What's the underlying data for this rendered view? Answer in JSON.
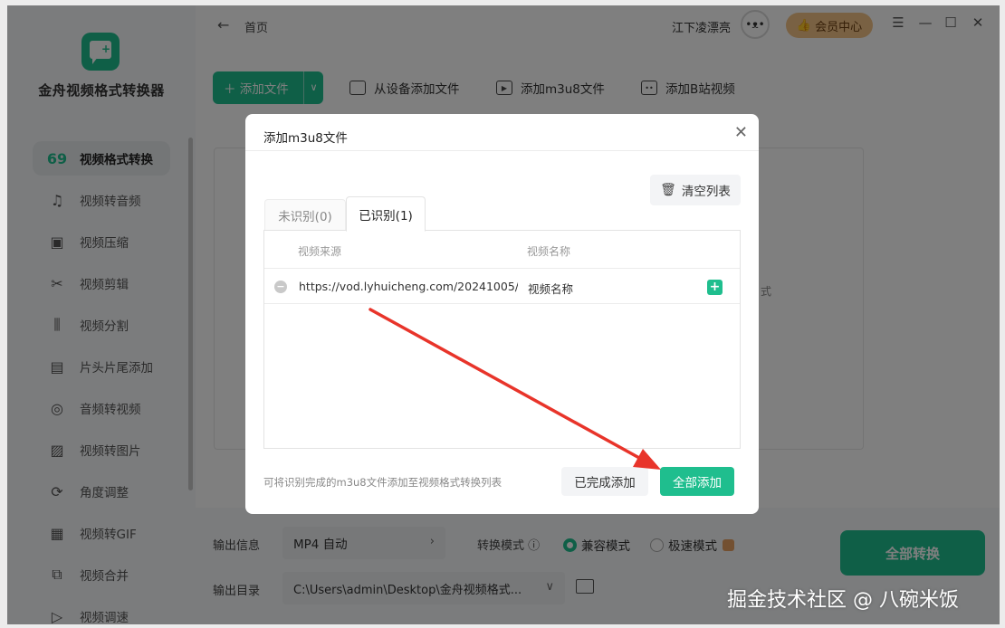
{
  "app": {
    "title": "金舟视频格式转换器"
  },
  "titlebar": {
    "back_icon": "arrow-left-icon",
    "crumb": "首页",
    "username": "江下凌漂亮",
    "vip_label": "会员中心"
  },
  "sidebar": {
    "items": [
      {
        "label": "视频格式转换",
        "icon": "format-convert-icon",
        "glyph": "69",
        "active": true
      },
      {
        "label": "视频转音频",
        "icon": "music-note-icon",
        "glyph": "♫"
      },
      {
        "label": "视频压缩",
        "icon": "compress-icon",
        "glyph": "▣"
      },
      {
        "label": "视频剪辑",
        "icon": "scissors-icon",
        "glyph": "✂"
      },
      {
        "label": "视频分割",
        "icon": "split-icon",
        "glyph": "⫼"
      },
      {
        "label": "片头片尾添加",
        "icon": "film-icon",
        "glyph": "▤"
      },
      {
        "label": "音频转视频",
        "icon": "disc-icon",
        "glyph": "◎"
      },
      {
        "label": "视频转图片",
        "icon": "image-icon",
        "glyph": "▨"
      },
      {
        "label": "角度调整",
        "icon": "rotate-icon",
        "glyph": "⟳"
      },
      {
        "label": "视频转GIF",
        "icon": "gif-icon",
        "glyph": "▦"
      },
      {
        "label": "视频合并",
        "icon": "merge-icon",
        "glyph": "⧉"
      },
      {
        "label": "视频调速",
        "icon": "speed-icon",
        "glyph": "▷"
      }
    ]
  },
  "toolbar": {
    "add_file": "添加文件",
    "add_from_device": "从设备添加文件",
    "add_m3u8": "添加m3u8文件",
    "add_bilibili": "添加B站视频"
  },
  "background": {
    "hint_fragment": "式"
  },
  "bottom": {
    "output_info_label": "输出信息",
    "output_format": "MP4 自动",
    "convert_mode_label": "转换模式",
    "mode_compatible": "兼容模式",
    "mode_fast": "极速模式",
    "output_dir_label": "输出目录",
    "output_dir": "C:\\Users\\admin\\Desktop\\金舟视频格式...",
    "convert_all": "全部转换"
  },
  "dialog": {
    "title": "添加m3u8文件",
    "clear_list": "清空列表",
    "tabs": [
      {
        "label": "未识别(0)"
      },
      {
        "label": "已识别(1)",
        "active": true
      }
    ],
    "columns": {
      "source": "视频来源",
      "name": "视频名称"
    },
    "rows": [
      {
        "source": "https://vod.lyhuicheng.com/20241005/y...",
        "name": "视频名称"
      }
    ],
    "footer_hint": "可将识别完成的m3u8文件添加至视频格式转换列表",
    "done_button": "已完成添加",
    "add_all_button": "全部添加"
  },
  "watermark": "掘金技术社区 @ 八碗米饭",
  "colors": {
    "accent": "#1fbe8e",
    "annotation_arrow": "#e8342a",
    "vip": "#f2c287"
  }
}
